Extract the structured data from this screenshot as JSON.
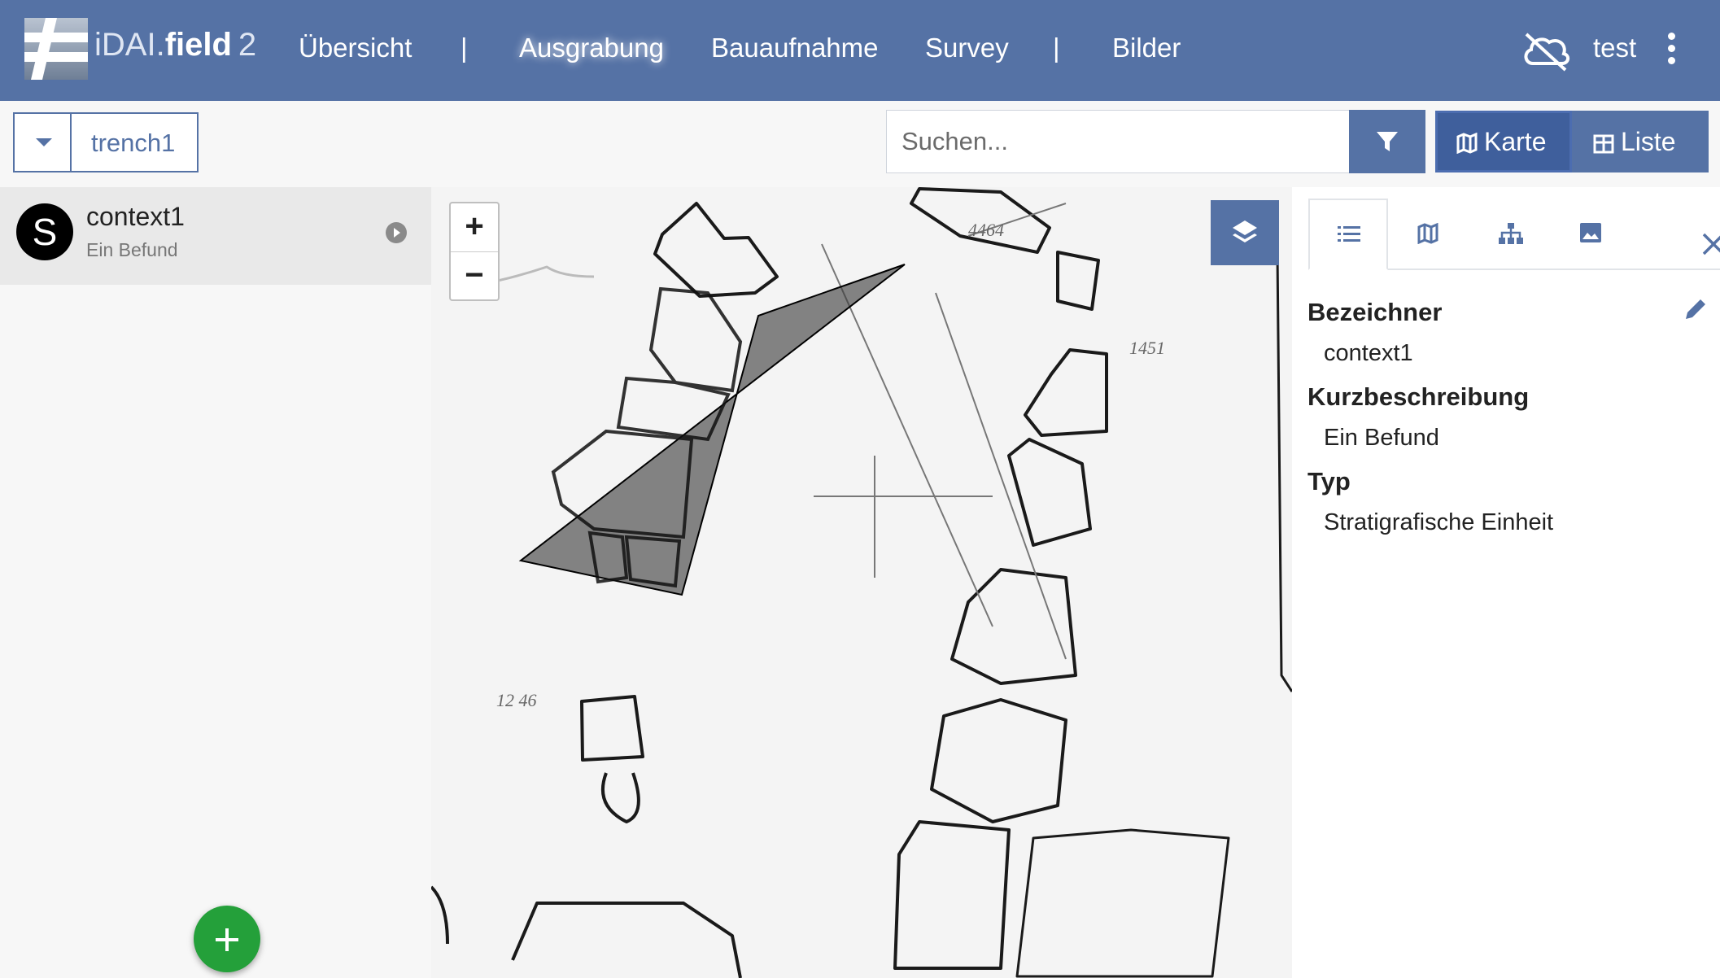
{
  "app": {
    "name_prefix": "iDAI.",
    "name_main": "field",
    "version": "2"
  },
  "nav": {
    "items": [
      "Übersicht",
      "Ausgrabung",
      "Bauaufnahme",
      "Survey",
      "Bilder"
    ],
    "separators": [
      "|",
      "|"
    ],
    "active": "Ausgrabung",
    "user": "test"
  },
  "toolbar": {
    "operation": "trench1",
    "search_placeholder": "Suchen...",
    "view_map_label": "Karte",
    "view_list_label": "Liste",
    "active_view": "Karte"
  },
  "list": {
    "items": [
      {
        "badge": "S",
        "title": "context1",
        "subtitle": "Ein Befund"
      }
    ]
  },
  "map": {
    "zoom_in": "+",
    "zoom_out": "−"
  },
  "detail": {
    "fields": [
      {
        "label": "Bezeichner",
        "value": "context1"
      },
      {
        "label": "Kurzbeschreibung",
        "value": "Ein Befund"
      },
      {
        "label": "Typ",
        "value": "Stratigrafische Einheit"
      }
    ]
  },
  "colors": {
    "brand": "#5572a5",
    "add": "#24a03a",
    "badge": "#000000"
  },
  "icons": [
    "cloud-off-icon",
    "kebab-menu-icon",
    "filter-icon",
    "map-icon",
    "table-icon",
    "layers-icon",
    "list-icon",
    "hierarchy-icon",
    "image-icon",
    "close-icon",
    "pencil-icon",
    "plus-icon"
  ]
}
